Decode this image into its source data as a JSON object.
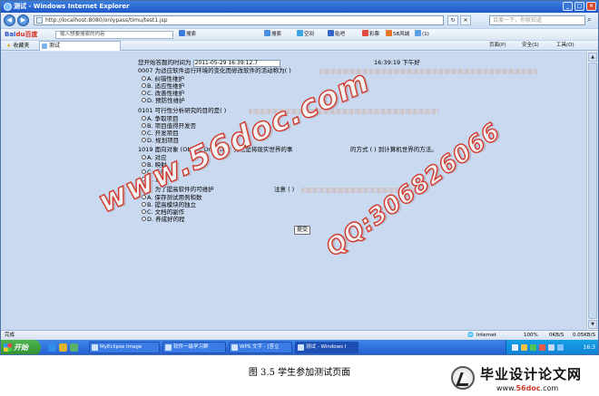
{
  "window": {
    "title": "测试 - Windows Internet Explorer",
    "minimize": "_",
    "maximize": "□",
    "close": "×"
  },
  "addressbar": {
    "back": "◀",
    "forward": "▶",
    "url": "http://localhost:8080/onlypass/timu/test1.jsp",
    "refresh": "↻",
    "stop": "✕",
    "search_placeholder": "百度一下，你就知道"
  },
  "toolbar": {
    "baidu_logo": "Bai",
    "baidu_logo_suffix": "du百度",
    "search_input": "输入想要搜索的内容",
    "search_label": "搜索",
    "items": [
      "搜索",
      "空间",
      "贴吧",
      "彩票",
      "SB风城",
      "(1)"
    ]
  },
  "favbar": {
    "favorites": "收藏夹",
    "tab_title": "测试",
    "commands": [
      "页面(P)",
      "安全(S)",
      "工具(O)"
    ]
  },
  "page": {
    "start_label": "您开始答题的时间为",
    "start_time": "2011-05-29 16:39:12.7",
    "clock": "16:39:19  下午好",
    "q1": "0007  为适应软件运行环境的变化而修改软件的活动称为(  )",
    "q1_options": [
      "A. 纠错性维护",
      "B. 适应性维护",
      "C. 改善性维护",
      "D. 预防性维护"
    ],
    "q2": "0101  可行性分析研究的目的是(  )",
    "q2_options": [
      "A. 争取项目",
      "B. 项目值得开发否",
      "C. 开发项目",
      "D. 规划项目"
    ],
    "q3_head": "1019  面向对象 (Object Oriented) 方法是将现实世界的事",
    "q3_tail": "的方式 (  ) 到计算机世界的方法。",
    "q3_options": [
      "A. 对应",
      "B. 映射",
      "C. 反映",
      "D. 反射"
    ],
    "q4_head": "1101  为了提高软件的可维护",
    "q4_tail": "注意 (  )",
    "q4_options": [
      "A. 保存测试用例和数",
      "B. 提高模块的独立",
      "C. 文档的副作",
      "D. 养成好的程"
    ],
    "submit": "提交"
  },
  "watermarks": {
    "site": "www.56doc.com",
    "qq": "QQ:306826066"
  },
  "statusbar": {
    "left": "完成",
    "zone": "Internet",
    "zoom": "100%",
    "speed_left": "0KB/S",
    "speed_right": "0.05KB/S"
  },
  "taskbar": {
    "start": "开始",
    "tasks": [
      "MyEclipse Image",
      "软件一级学习群",
      "WPS 文字 - [答立",
      "测试 - Windows I"
    ],
    "clock": "16:3"
  },
  "caption": {
    "figure": "图 3.5  学生参加测试页面",
    "logo_title": "毕业设计论文网",
    "logo_url_prefix": "www.",
    "logo_url_accent": "56doc",
    "logo_url_suffix": ".com"
  },
  "colors": {
    "title_blue": "#1f58c8",
    "content_bg": "#c9d9ef",
    "watermark_red": "#d23a2d"
  }
}
